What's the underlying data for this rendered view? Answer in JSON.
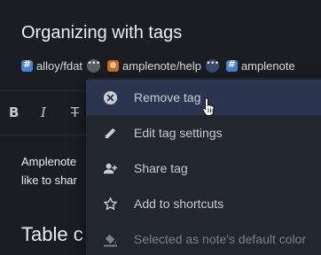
{
  "note": {
    "title": "Organizing with tags",
    "tags": [
      {
        "label": "alloy/fdat",
        "kind": "hash"
      },
      {
        "label": "amplenote/help",
        "kind": "shared"
      },
      {
        "label": "amplenote",
        "kind": "hash"
      }
    ],
    "body_lines": [
      "Amplenote",
      "like to shar"
    ],
    "heading": "Table c"
  },
  "toolbar": {
    "bold": "B",
    "italic": "I",
    "strike": "T"
  },
  "tag_menu": {
    "items": [
      {
        "label": "Remove tag",
        "icon": "remove-circle-icon",
        "state": "hover"
      },
      {
        "label": "Edit tag settings",
        "icon": "pencil-icon",
        "state": "normal"
      },
      {
        "label": "Share tag",
        "icon": "person-add-icon",
        "state": "normal"
      },
      {
        "label": "Add to shortcuts",
        "icon": "star-icon",
        "state": "normal"
      },
      {
        "label": "Selected as note's default color",
        "icon": "paint-bucket-icon",
        "state": "disabled"
      }
    ]
  },
  "colors": {
    "background": "#1a1d22",
    "menu": "#22262d",
    "hover": "#2b3550",
    "hash_tag": "#4a7fd6",
    "shared_tag": "#c96a2a"
  }
}
